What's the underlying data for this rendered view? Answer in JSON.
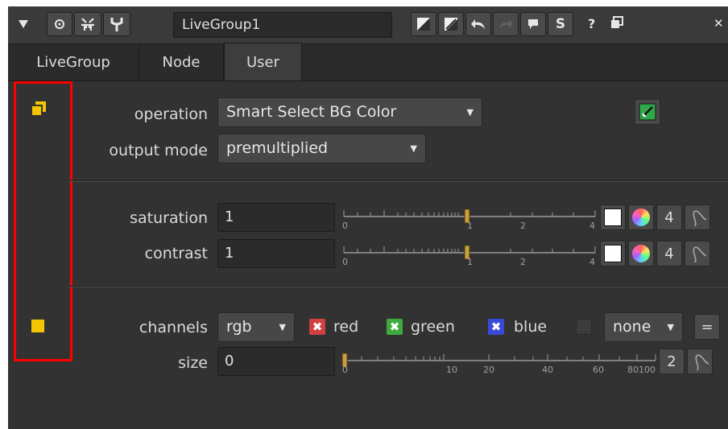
{
  "titlebar": {
    "name": "LiveGroup1",
    "buttons": [
      "collapse-arrow",
      "viewer-node",
      "split-node",
      "wrench",
      "input-color",
      "output-color",
      "undo",
      "redo",
      "revert",
      "s-button",
      "help",
      "float",
      "close"
    ],
    "s_label": "S",
    "help_label": "?",
    "float_label": "🗗",
    "close_label": "✕"
  },
  "tabs": [
    {
      "label": "LiveGroup"
    },
    {
      "label": "Node"
    },
    {
      "label": "User"
    }
  ],
  "knobs": {
    "operation": {
      "label": "operation",
      "value": "Smart Select BG Color"
    },
    "output_mode": {
      "label": "output mode",
      "value": "premultiplied"
    },
    "saturation": {
      "label": "saturation",
      "value": "1",
      "ticks": [
        "0",
        "1",
        "2",
        "4"
      ],
      "count": "4"
    },
    "contrast": {
      "label": "contrast",
      "value": "1",
      "ticks": [
        "0",
        "1",
        "2",
        "4"
      ],
      "count": "4"
    },
    "channels": {
      "label": "channels",
      "value": "rgb",
      "red": "red",
      "green": "green",
      "blue": "blue",
      "extra": "none",
      "eq": "="
    },
    "size": {
      "label": "size",
      "value": "0",
      "ticks": [
        "0",
        "10",
        "20",
        "40",
        "60",
        "80",
        "100"
      ],
      "count": "2"
    }
  },
  "colors": {
    "accent_yellow": "#f5c400",
    "highlight_red": "#ff0000",
    "red_cb": "#d04040",
    "green_cb": "#3faa3f",
    "blue_cb": "#3a4ad8"
  }
}
